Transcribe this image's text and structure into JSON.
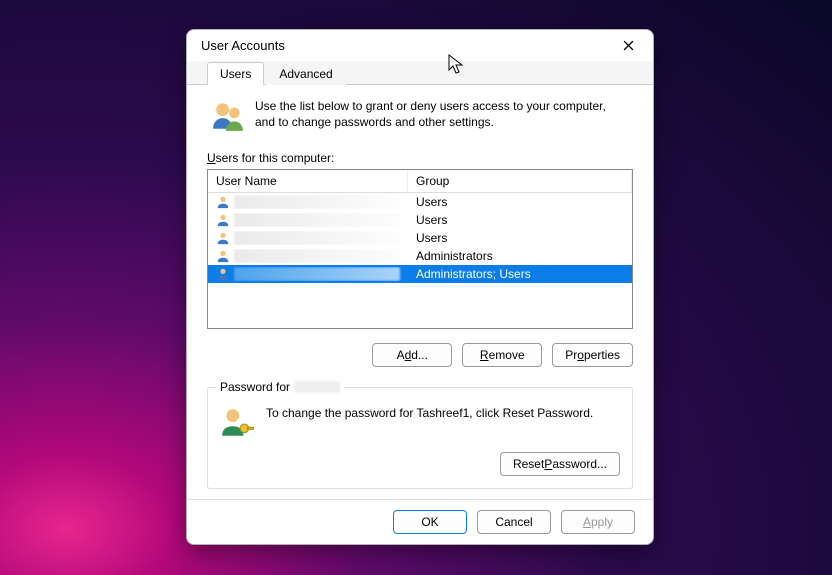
{
  "dialog": {
    "title": "User Accounts",
    "tabs": [
      "Users",
      "Advanced"
    ],
    "active_tab": 0,
    "intro_text": "Use the list below to grant or deny users access to your computer, and to change passwords and other settings.",
    "list_label": "Users for this computer:",
    "list_label_mnemonic": "U",
    "columns": {
      "username": "User Name",
      "group": "Group"
    },
    "rows": [
      {
        "username": "",
        "group": "Users",
        "selected": false
      },
      {
        "username": "",
        "group": "Users",
        "selected": false
      },
      {
        "username": "",
        "group": "Users",
        "selected": false
      },
      {
        "username": "",
        "group": "Administrators",
        "selected": false
      },
      {
        "username": "",
        "group": "Administrators; Users",
        "selected": true
      }
    ],
    "buttons": {
      "add": "Add...",
      "remove": "Remove",
      "properties": "Properties"
    },
    "password_group": {
      "legend_prefix": "Password for ",
      "legend_user": "",
      "text": "To change the password for Tashreef1, click Reset Password.",
      "reset_button": "Reset Password..."
    },
    "footer": {
      "ok": "OK",
      "cancel": "Cancel",
      "apply": "Apply",
      "apply_enabled": false
    }
  }
}
